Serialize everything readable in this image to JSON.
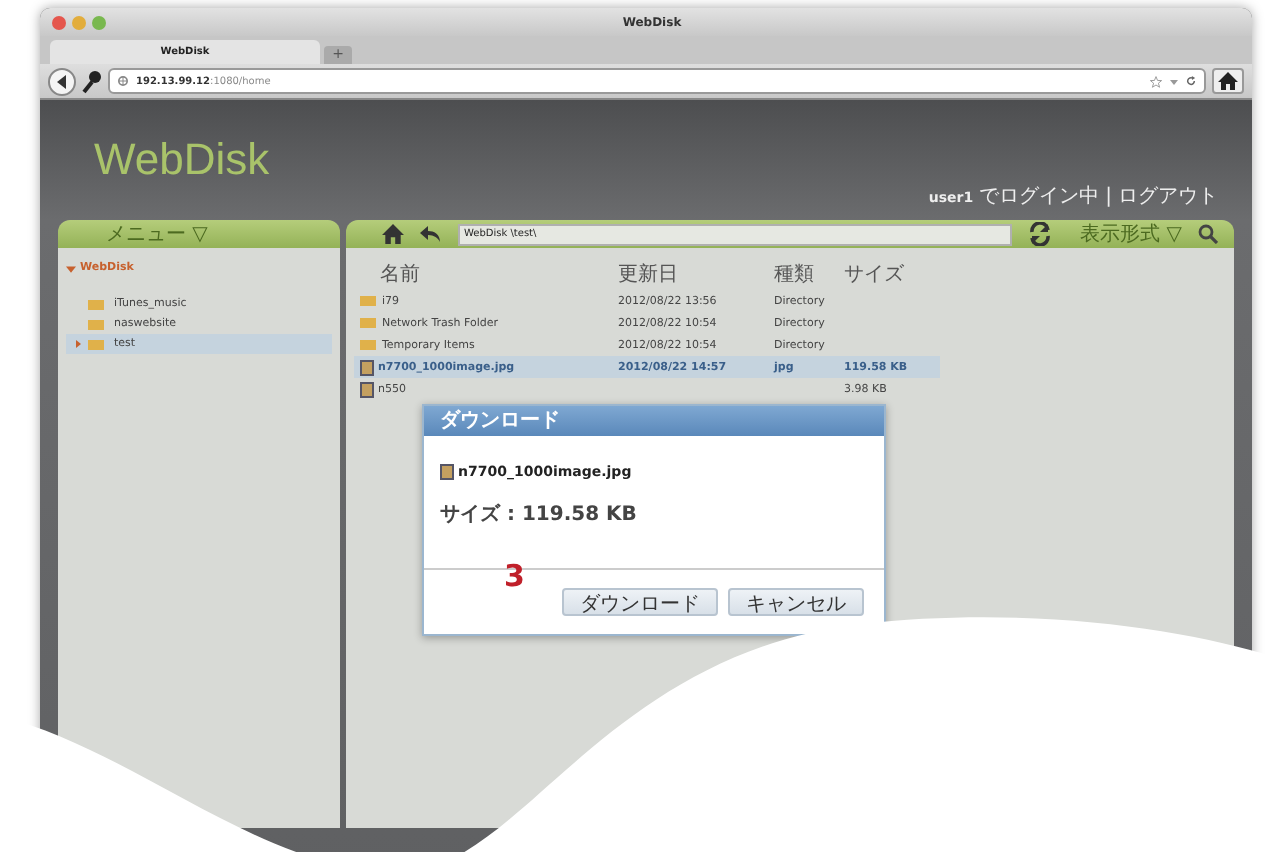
{
  "window": {
    "title": "WebDisk"
  },
  "tabs": [
    {
      "label": "WebDisk",
      "selected": true
    }
  ],
  "new_tab": "+",
  "address_bar": {
    "host": "192.13.99.12",
    "path": ":1080/home"
  },
  "app": {
    "logo": "WebDisk",
    "user": "user1",
    "login_status": "でログイン中",
    "separator": "|",
    "logout": "ログアウト"
  },
  "menu": {
    "label": "メニュー ▽"
  },
  "toolbar": {
    "path": "WebDisk \\test\\",
    "view_mode": "表示形式 ▽"
  },
  "tree": [
    {
      "label": "WebDisk",
      "expanded": true,
      "selected": false,
      "children": [
        {
          "label": "iTunes_music",
          "selected": false
        },
        {
          "label": "naswebsite",
          "selected": false
        },
        {
          "label": "test",
          "selected": true
        }
      ]
    }
  ],
  "table": {
    "columns": [
      "名前",
      "更新日",
      "種類",
      "サイズ"
    ],
    "rows": [
      {
        "kind": "folder",
        "name": "i79",
        "date": "2012/08/22 13:56",
        "type": "Directory",
        "size": "",
        "selected": false
      },
      {
        "kind": "folder",
        "name": "Network Trash Folder",
        "date": "2012/08/22 10:54",
        "type": "Directory",
        "size": "",
        "selected": false
      },
      {
        "kind": "folder",
        "name": "Temporary Items",
        "date": "2012/08/22 10:54",
        "type": "Directory",
        "size": "",
        "selected": false
      },
      {
        "kind": "file",
        "name": "n7700_1000image.jpg",
        "date": "2012/08/22 14:57",
        "type": "jpg",
        "size": "119.58 KB",
        "selected": true
      },
      {
        "kind": "file",
        "name": "n550",
        "date": "",
        "type": "",
        "size": "3.98 KB",
        "selected": false
      }
    ]
  },
  "dialog": {
    "title": "ダウンロード",
    "file": "n7700_1000image.jpg",
    "size": "サイズ : 119.58 KB",
    "buttons": [
      "ダウンロード",
      "キャンセル"
    ]
  },
  "step_marker": "3"
}
